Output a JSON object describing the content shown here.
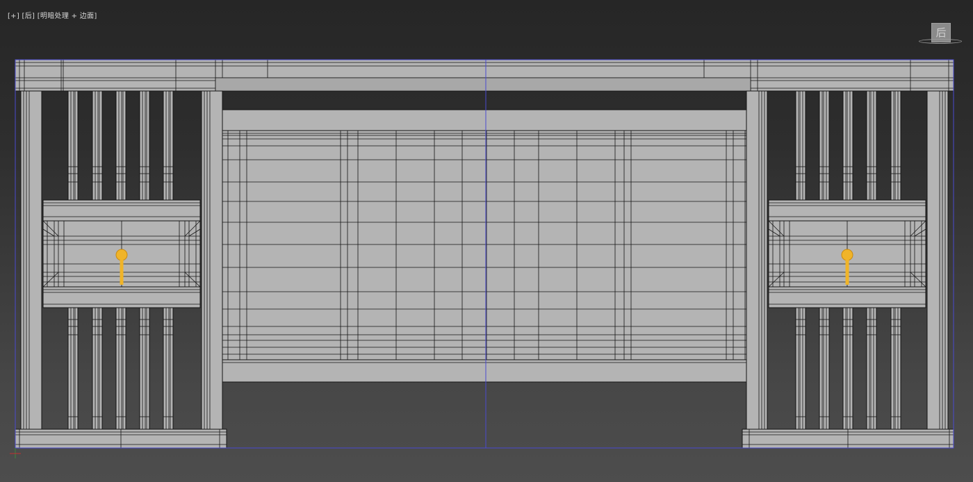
{
  "viewport": {
    "menu_plus": "[+]",
    "view_name": "[后]",
    "shading_mode": "[明暗处理 + 边面]"
  },
  "viewcube": {
    "face_label": "后",
    "icon": "viewcube-icon"
  },
  "colors": {
    "mesh_fill": "#b4b4b4",
    "wire": "#141414",
    "selection_box": "#4a4ad0",
    "key": "#f0b429"
  }
}
